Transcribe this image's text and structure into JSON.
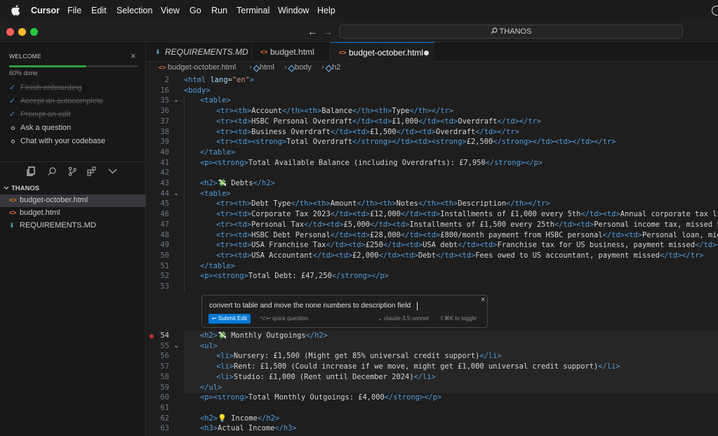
{
  "menubar": {
    "app_name": "Cursor",
    "items": [
      "File",
      "Edit",
      "Selection",
      "View",
      "Go",
      "Run",
      "Terminal",
      "Window",
      "Help"
    ]
  },
  "titlebar": {
    "search_text": "THANOS",
    "back": "←",
    "forward": "→"
  },
  "welcome": {
    "title": "WELCOME",
    "close": "×",
    "progress_label": "60% done",
    "progress": 0.6,
    "tasks": [
      {
        "label": "Finish onboarding",
        "done": true
      },
      {
        "label": "Accept an autocomplete",
        "done": true
      },
      {
        "label": "Prompt an edit",
        "done": true
      },
      {
        "label": "Ask a question",
        "done": false
      },
      {
        "label": "Chat with your codebase",
        "done": false
      }
    ]
  },
  "explorer": {
    "section": "THANOS",
    "files": [
      {
        "name": "budget-october.html",
        "icon": "html-file-icon",
        "active": true
      },
      {
        "name": "budget.html",
        "icon": "html-file-icon",
        "active": false
      },
      {
        "name": "REQUIREMENTS.MD",
        "icon": "markdown-file-icon",
        "active": false
      }
    ]
  },
  "tabs": [
    {
      "label": "REQUIREMENTS.MD",
      "icon": "markdown-file-icon",
      "active": false
    },
    {
      "label": "budget.html",
      "icon": "html-file-icon",
      "active": false
    },
    {
      "label": "budget-october.html",
      "icon": "html-file-icon",
      "active": true,
      "modified": true
    }
  ],
  "breadcrumb": [
    "budget-october.html",
    "html",
    "body",
    "h2"
  ],
  "code_lines": [
    {
      "n": "2",
      "t": "<html lang=\"en\">",
      "i": 0
    },
    {
      "n": "16",
      "t": "<body>",
      "i": 0
    },
    {
      "n": "35",
      "t": "<table>",
      "i": 1,
      "fold": true
    },
    {
      "n": "36",
      "t": "<tr><th>Account</th><th>Balance</th><th>Type</th></tr>",
      "i": 2
    },
    {
      "n": "37",
      "t": "<tr><td>HSBC Personal Overdraft</td><td>£1,000</td><td>Overdraft</td></tr>",
      "i": 2
    },
    {
      "n": "38",
      "t": "<tr><td>Business Overdraft</td><td>£1,500</td><td>Overdraft</td></tr>",
      "i": 2
    },
    {
      "n": "39",
      "t": "<tr><td><strong>Total Overdraft</strong></td><td><strong>£2,500</strong></td><td></td></tr>",
      "i": 2
    },
    {
      "n": "40",
      "t": "</table>",
      "i": 1
    },
    {
      "n": "41",
      "t": "<p><strong>Total Available Balance (including Overdrafts): £7,950</strong></p>",
      "i": 1
    },
    {
      "n": "42",
      "t": "",
      "i": 0
    },
    {
      "n": "43",
      "t": "<h2>💸 Debts</h2>",
      "i": 1
    },
    {
      "n": "44",
      "t": "<table>",
      "i": 1,
      "fold": true
    },
    {
      "n": "45",
      "t": "<tr><th>Debt Type</th><th>Amount</th><th>Notes</th><th>Description</th></tr>",
      "i": 2
    },
    {
      "n": "46",
      "t": "<tr><td>Corporate Tax 2023</td><td>£12,000</td><td>Installments of £1,000 every 5th</td><td>Annual corporate tax liabilit",
      "i": 2
    },
    {
      "n": "47",
      "t": "<tr><td>Personal Tax</td><td>£5,000</td><td>Installments of £1,500 every 25th</td><td>Personal income tax, missed Septemb",
      "i": 2
    },
    {
      "n": "48",
      "t": "<tr><td>HSBC Debt Personal</td><td>£28,000</td><td>£800/month payment from HSBC personal</td><td>Personal loan, might mis",
      "i": 2
    },
    {
      "n": "49",
      "t": "<tr><td>USA Franchise Tax</td><td>£250</td><td>USA debt</td><td>Franchise tax for US business, payment missed</td></tr>",
      "i": 2
    },
    {
      "n": "50",
      "t": "<tr><td>USA Accountant</td><td>£2,000</td><td>Debt</td><td>Fees owed to US accountant, payment missed</td></tr>",
      "i": 2
    },
    {
      "n": "51",
      "t": "</table>",
      "i": 1
    },
    {
      "n": "52",
      "t": "<p><strong>Total Debt: £47,250</strong></p>",
      "i": 1
    },
    {
      "n": "53",
      "t": "",
      "i": 0
    }
  ],
  "code_lines_after": [
    {
      "n": "54",
      "t": "<h2>💸 Monthly Outgoings</h2>",
      "i": 1,
      "hl": true,
      "dot": true
    },
    {
      "n": "55",
      "t": "<ul>",
      "i": 1,
      "hl": true,
      "fold": true
    },
    {
      "n": "56",
      "t": "<li>Nursery: £1,500 (Might get 85% universal credit support)</li>",
      "i": 2,
      "hl": true
    },
    {
      "n": "57",
      "t": "<li>Rent: £1,500 (Could increase if we move, might get £1,000 universal credit support)</li>",
      "i": 2,
      "hl": true
    },
    {
      "n": "58",
      "t": "<li>Studio: £1,000 (Rent until December 2024)</li>",
      "i": 2,
      "hl": true
    },
    {
      "n": "59",
      "t": "</ul>",
      "i": 1,
      "hl": true
    },
    {
      "n": "60",
      "t": "<p><strong>Total Monthly Outgoings: £4,000</strong></p>",
      "i": 1
    },
    {
      "n": "61",
      "t": "",
      "i": 0
    },
    {
      "n": "62",
      "t": "<h2>💡 Income</h2>",
      "i": 1
    },
    {
      "n": "63",
      "t": "<h3>Actual Income</h3>",
      "i": 1
    }
  ],
  "prompt_box": {
    "text": "convert to table and move the none numbers to description field",
    "submit_label": "↩ Submit Edit",
    "quick_question": "⌥↩ quick question",
    "model": "⌄ claude-3.5-sonnet",
    "toggle": "⇧⌘K to toggle",
    "close": "×"
  },
  "colors": {
    "accent": "#0078d4",
    "progress": "#2ea043",
    "breakpoint": "#c72e2e"
  }
}
